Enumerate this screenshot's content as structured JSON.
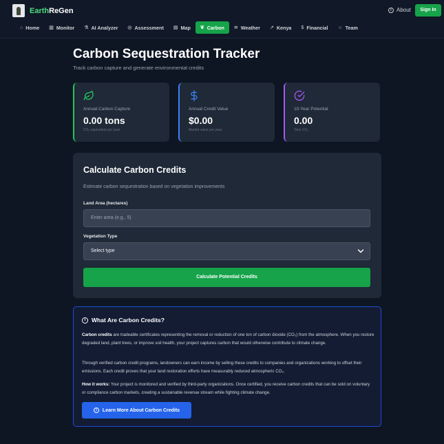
{
  "app": {
    "brand_part1": "Earth",
    "brand_part2": "ReGen",
    "about_label": "About",
    "signin_label": "Sign In"
  },
  "nav": [
    {
      "label": "Home",
      "icon": "home-icon",
      "glyph": "⌂"
    },
    {
      "label": "Monitor",
      "icon": "chart-icon",
      "glyph": "▥"
    },
    {
      "label": "AI Analyzer",
      "icon": "flask-icon",
      "glyph": "⚗"
    },
    {
      "label": "Assessment",
      "icon": "check-circle-icon",
      "glyph": "◎"
    },
    {
      "label": "Map",
      "icon": "map-icon",
      "glyph": "▤"
    },
    {
      "label": "Carbon",
      "icon": "leaf-icon",
      "glyph": "❦",
      "active": true
    },
    {
      "label": "Weather",
      "icon": "wind-icon",
      "glyph": "≋"
    },
    {
      "label": "Kenya",
      "icon": "trend-icon",
      "glyph": "↗"
    },
    {
      "label": "Financial",
      "icon": "dollar-icon",
      "glyph": "$"
    },
    {
      "label": "Team",
      "icon": "users-icon",
      "glyph": "☺"
    }
  ],
  "page": {
    "title": "Carbon Sequestration Tracker",
    "subtitle": "Track carbon capture and generate environmental credits"
  },
  "stats": [
    {
      "label": "Annual Carbon Capture",
      "value": "0.00 tons",
      "sub": "CO₂ equivalent per year",
      "icon": "leaf-icon",
      "color": "#22c55e"
    },
    {
      "label": "Annual Credit Value",
      "value": "$0.00",
      "sub": "Market value per year",
      "icon": "dollar-icon",
      "color": "#3b82f6"
    },
    {
      "label": "10-Year Potential",
      "value": "0.00",
      "sub": "Tons CO₂",
      "icon": "check-circle-icon",
      "color": "#a855f7"
    }
  ],
  "calculator": {
    "title": "Calculate Carbon Credits",
    "description": "Estimate carbon sequestration based on vegetation improvements",
    "land_label": "Land Area (hectares)",
    "land_placeholder": "Enter area (e.g., 5)",
    "veg_label": "Vegetation Type",
    "veg_selected": "Select type",
    "button_label": "Calculate Potential Credits"
  },
  "info": {
    "title": "What Are Carbon Credits?",
    "p1_bold": "Carbon credits",
    "p1_text": " are tradeable certificates representing the removal or reduction of one ton of carbon dioxide (CO₂) from the atmosphere. When you restore degraded land, plant trees, or improve soil health, your project captures carbon that would otherwise contribute to climate change.",
    "p2_text": "Through verified carbon credit programs, landowners can earn income by selling these credits to companies and organizations working to offset their emissions. Each credit proves that your land restoration efforts have measurably reduced atmospheric CO₂.",
    "p3_bold": "How it works:",
    "p3_text": " Your project is monitored and verified by third-party organizations. Once certified, you receive carbon credits that can be sold on voluntary or compliance carbon markets, creating a sustainable revenue stream while fighting climate change.",
    "button_label": "Learn More About Carbon Credits"
  },
  "colors": {
    "accent_green": "#16a34a",
    "accent_blue": "#2563eb",
    "accent_purple": "#a855f7"
  }
}
